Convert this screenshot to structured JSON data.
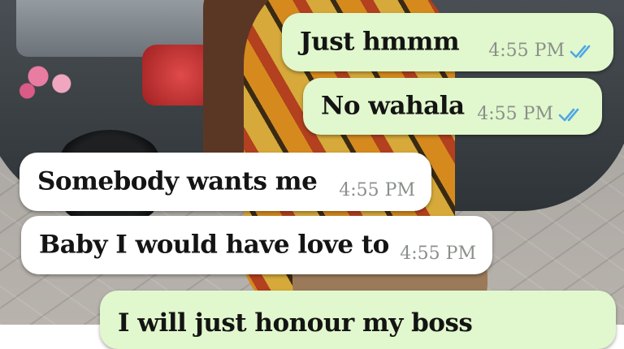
{
  "messages": [
    {
      "direction": "outgoing",
      "text": "Just hmmm",
      "time": "4:55 PM",
      "status": "read-double-tick"
    },
    {
      "direction": "outgoing",
      "text": "No wahala",
      "time": "4:55 PM",
      "status": "read-double-tick"
    },
    {
      "direction": "incoming",
      "text": "Somebody wants me",
      "time": "4:55 PM"
    },
    {
      "direction": "incoming",
      "text": "Baby I would have love to",
      "time": "4:55 PM"
    },
    {
      "direction": "outgoing",
      "text": "I will just honour my boss",
      "time": ""
    }
  ],
  "colors": {
    "outgoing_bubble": "#e1f7cd",
    "incoming_bubble": "#ffffff",
    "read_tick": "#4fa8e4",
    "timestamp": "#8a8f8a"
  }
}
